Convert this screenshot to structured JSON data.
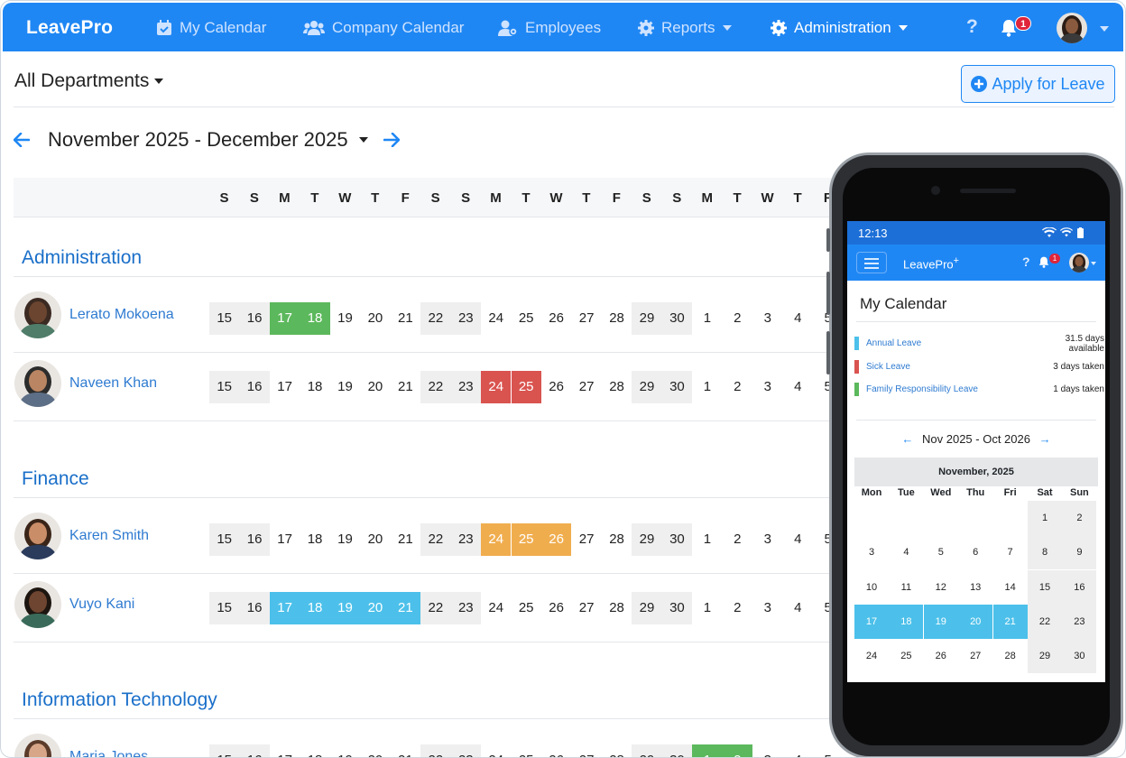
{
  "nav": {
    "brand": "LeavePro",
    "items": [
      {
        "label": "My Calendar",
        "icon": "calendar-check-icon"
      },
      {
        "label": "Company Calendar",
        "icon": "users-icon"
      },
      {
        "label": "Employees",
        "icon": "user-gear-icon"
      },
      {
        "label": "Reports",
        "icon": "gear-icon"
      },
      {
        "label": "Administration",
        "icon": "gear-icon",
        "active": true
      }
    ],
    "help": "?",
    "notification_count": "1"
  },
  "toolbar": {
    "department_filter": "All Departments",
    "apply_button": "Apply for Leave",
    "date_range": "November 2025 - December 2025"
  },
  "calendar": {
    "weekday_headers": [
      "S",
      "S",
      "M",
      "T",
      "W",
      "T",
      "F",
      "S",
      "S",
      "M",
      "T",
      "W",
      "T",
      "F",
      "S",
      "S",
      "M",
      "T",
      "W",
      "T",
      "F"
    ],
    "day_numbers": [
      "15",
      "16",
      "17",
      "18",
      "19",
      "20",
      "21",
      "22",
      "23",
      "24",
      "25",
      "26",
      "27",
      "28",
      "29",
      "30",
      "1",
      "2",
      "3",
      "4",
      "5"
    ],
    "weekend_index": [
      0,
      1,
      7,
      8,
      14,
      15
    ],
    "departments": [
      {
        "name": "Administration",
        "employees": [
          {
            "name": "Lerato Mokoena",
            "leave": [
              2,
              3
            ],
            "leave_color": "#5cb85c"
          },
          {
            "name": "Naveen Khan",
            "leave": [
              9,
              10
            ],
            "leave_color": "#d9534f"
          }
        ]
      },
      {
        "name": "Finance",
        "employees": [
          {
            "name": "Karen Smith",
            "leave": [
              9,
              10,
              11
            ],
            "leave_color": "#f0ad4e"
          },
          {
            "name": "Vuyo Kani",
            "leave": [
              2,
              3,
              4,
              5,
              6
            ],
            "leave_color": "#4cc0ea"
          }
        ]
      },
      {
        "name": "Information Technology",
        "employees": [
          {
            "name": "Maria Jones",
            "leave": [
              16,
              17
            ],
            "leave_color": "#5cb85c"
          }
        ]
      }
    ]
  },
  "phone": {
    "time": "12:13",
    "brand": "LeavePro",
    "brand_mark": "+",
    "help": "?",
    "notification_count": "1",
    "title": "My Calendar",
    "leave_types": [
      {
        "name": "Annual Leave",
        "detail": "31.5 days available",
        "color": "#4cc0ea"
      },
      {
        "name": "Sick Leave",
        "detail": "3 days taken",
        "color": "#d9534f"
      },
      {
        "name": "Family Responsibility Leave",
        "detail": "1 days taken",
        "color": "#5cb85c"
      }
    ],
    "range": "Nov 2025 - Oct 2026",
    "month_title": "November, 2025",
    "weekdays": [
      "Mon",
      "Tue",
      "Wed",
      "Thu",
      "Fri",
      "Sat",
      "Sun"
    ],
    "weeks": [
      [
        "",
        "",
        "",
        "",
        "",
        "1",
        "2"
      ],
      [
        "3",
        "4",
        "5",
        "6",
        "7",
        "8",
        "9"
      ],
      [
        "10",
        "11",
        "12",
        "13",
        "14",
        "15",
        "16"
      ],
      [
        "17",
        "18",
        "19",
        "20",
        "21",
        "22",
        "23"
      ],
      [
        "24",
        "25",
        "26",
        "27",
        "28",
        "29",
        "30"
      ]
    ],
    "leave_days": [
      "17",
      "18",
      "19",
      "20",
      "21"
    ]
  }
}
